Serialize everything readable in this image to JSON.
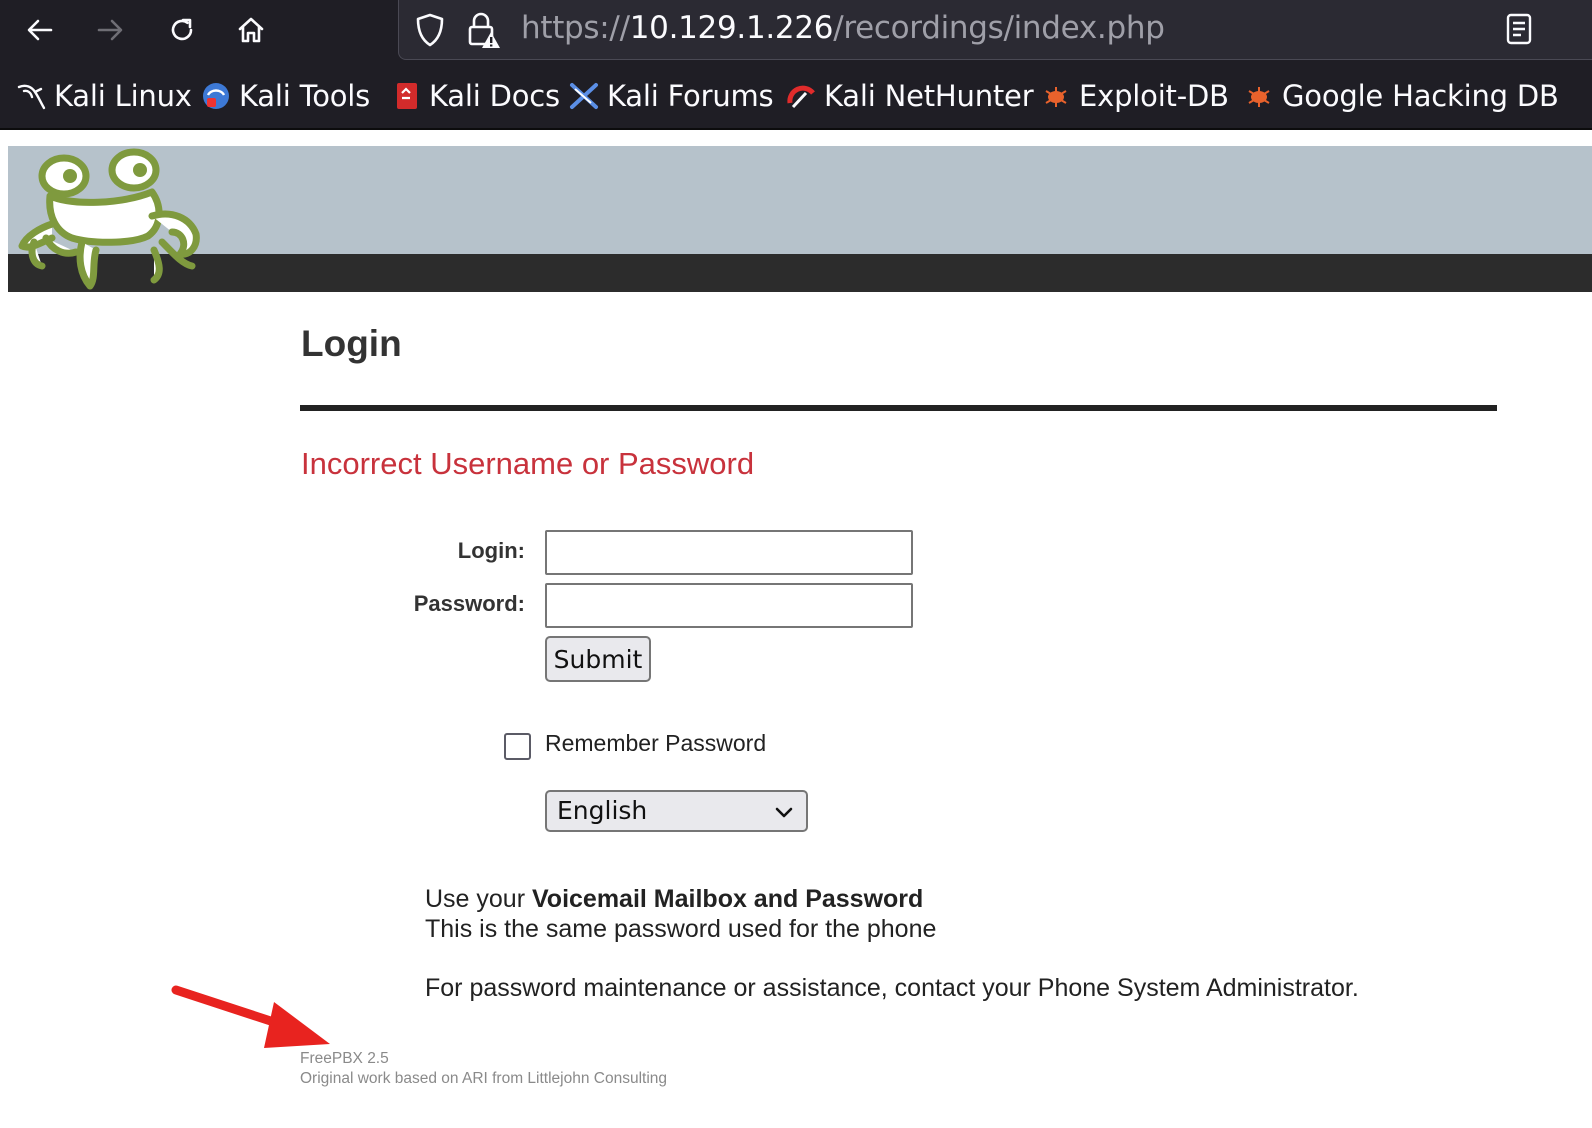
{
  "browser": {
    "url_scheme": "https://",
    "url_host": "10.129.1.226",
    "url_path": "/recordings/index.php",
    "bookmarks": [
      {
        "label": "Kali Linux",
        "icon": "kali-dragon-icon"
      },
      {
        "label": "Kali Tools",
        "icon": "kali-tools-icon"
      },
      {
        "label": "Kali Docs",
        "icon": "kali-docs-icon"
      },
      {
        "label": "Kali Forums",
        "icon": "kali-forums-icon"
      },
      {
        "label": "Kali NetHunter",
        "icon": "kali-nethunter-icon"
      },
      {
        "label": "Exploit-DB",
        "icon": "exploit-db-icon"
      },
      {
        "label": "Google Hacking DB",
        "icon": "ghdb-icon"
      }
    ]
  },
  "page": {
    "title": "Login",
    "error": "Incorrect Username or Password",
    "form": {
      "login_label": "Login:",
      "login_value": "",
      "password_label": "Password:",
      "password_value": "",
      "submit_label": "Submit",
      "remember_label": "Remember Password",
      "remember_checked": false,
      "language_selected": "English"
    },
    "info": {
      "line1_prefix": "Use your ",
      "line1_bold": "Voicemail Mailbox and Password",
      "line2": "This is the same password used for the phone",
      "line3": "For password maintenance or assistance, contact your Phone System Administrator."
    },
    "footer": {
      "version": "FreePBX 2.5",
      "credit": "Original work based on ARI from Littlejohn Consulting"
    }
  },
  "colors": {
    "header_light": "#b6c2cb",
    "header_dark": "#2c2c2c",
    "error": "#c8323c",
    "annotation_arrow": "#e8231f",
    "frog_green": "#7f9a3e"
  }
}
